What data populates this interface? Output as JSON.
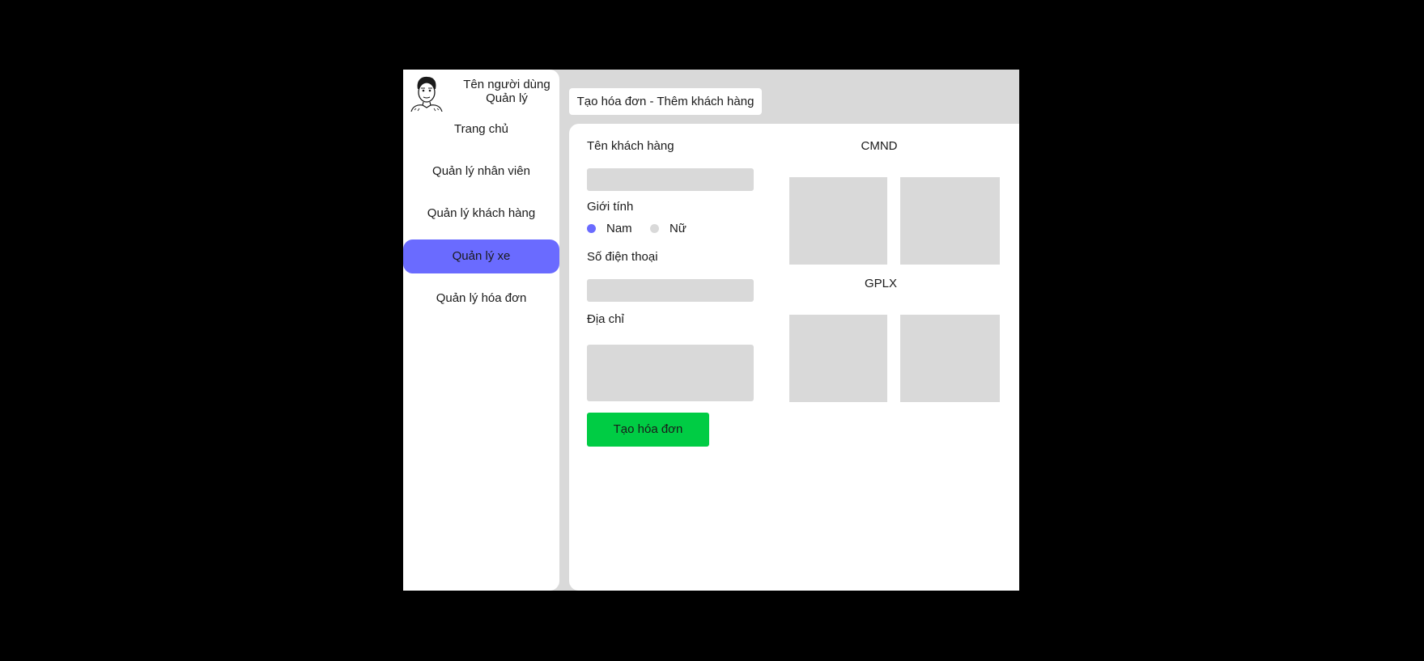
{
  "sidebar": {
    "user_name": "Tên người dùng",
    "user_role": "Quản lý",
    "avatar_icon": "user-avatar-sketch",
    "items": [
      {
        "label": "Trang chủ"
      },
      {
        "label": "Quản lý nhân viên"
      },
      {
        "label": "Quản lý khách hàng"
      },
      {
        "label": "Quản lý xe",
        "active": true
      },
      {
        "label": "Quản lý hóa đơn"
      }
    ]
  },
  "header": {
    "tab_label": "Tạo hóa đơn - Thêm khách hàng"
  },
  "form": {
    "customer_name_label": "Tên khách hàng",
    "customer_name_value": "",
    "gender_label": "Giới tính",
    "gender_options": [
      {
        "label": "Nam",
        "selected": true
      },
      {
        "label": "Nữ",
        "selected": false
      }
    ],
    "phone_label": "Số điện thoại",
    "phone_value": "",
    "address_label": "Địa chỉ",
    "address_value": "",
    "submit_label": "Tạo hóa đơn"
  },
  "documents": {
    "id_card_title": "CMND",
    "license_title": "GPLX"
  },
  "colors": {
    "accent": "#6a6bff",
    "submit": "#00cc44",
    "field_bg": "#d9d9d9",
    "app_bg": "#d9d9d9"
  }
}
